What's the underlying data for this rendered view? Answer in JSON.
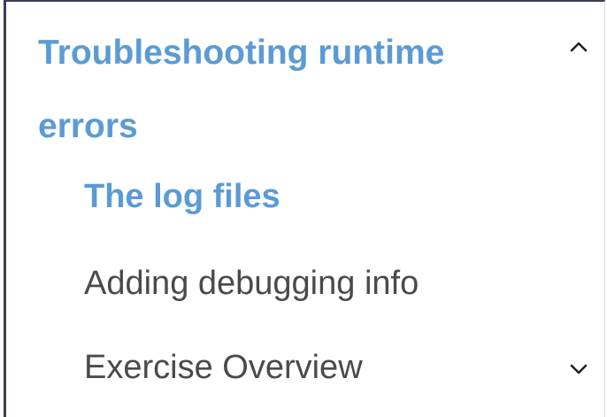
{
  "colors": {
    "accent": "#5b9bd5",
    "text": "#4a4a4a",
    "border": "#3a3f58"
  },
  "section": {
    "title": "Troubleshooting runtime errors",
    "expanded": true,
    "collapse_icon": "chevron-up-icon"
  },
  "items": [
    {
      "label": "The log files",
      "active": true
    },
    {
      "label": "Adding debugging info",
      "active": false
    },
    {
      "label": "Exercise Overview",
      "active": false,
      "icon": "chevron-down-icon"
    }
  ]
}
